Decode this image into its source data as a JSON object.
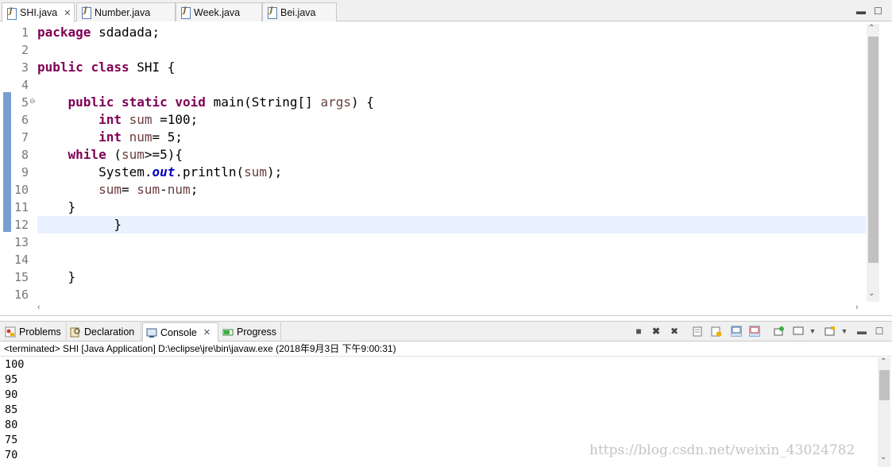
{
  "editor_tabs": [
    {
      "label": "SHI.java",
      "active": true,
      "closable": true
    },
    {
      "label": "Number.java",
      "active": false
    },
    {
      "label": "Week.java",
      "active": false
    },
    {
      "label": "Bei.java",
      "active": false
    }
  ],
  "editor": {
    "line_numbers": [
      "1",
      "2",
      "3",
      "4",
      "5",
      "6",
      "7",
      "8",
      "9",
      "10",
      "11",
      "12",
      "13",
      "14",
      "15",
      "16"
    ],
    "current_line": 12,
    "fold_marker": "⊖"
  },
  "panel_tabs": [
    {
      "label": "Problems",
      "icon": "problems-icon"
    },
    {
      "label": "Declaration",
      "icon": "declaration-icon"
    },
    {
      "label": "Console",
      "icon": "console-icon",
      "active": true,
      "closable": true
    },
    {
      "label": "Progress",
      "icon": "progress-icon"
    }
  ],
  "console": {
    "status": "<terminated> SHI [Java Application] D:\\eclipse\\jre\\bin\\javaw.exe (2018年9月3日 下午9:00:31)",
    "output": [
      "100",
      "95",
      "90",
      "85",
      "80",
      "75",
      "70"
    ]
  },
  "watermark": "https://blog.csdn.net/weixin_43024782",
  "colors": {
    "keyword": "#7f0055",
    "local_variable": "#6a3e3e",
    "static_field": "#0000c0",
    "current_line": "#e8f2fe"
  }
}
